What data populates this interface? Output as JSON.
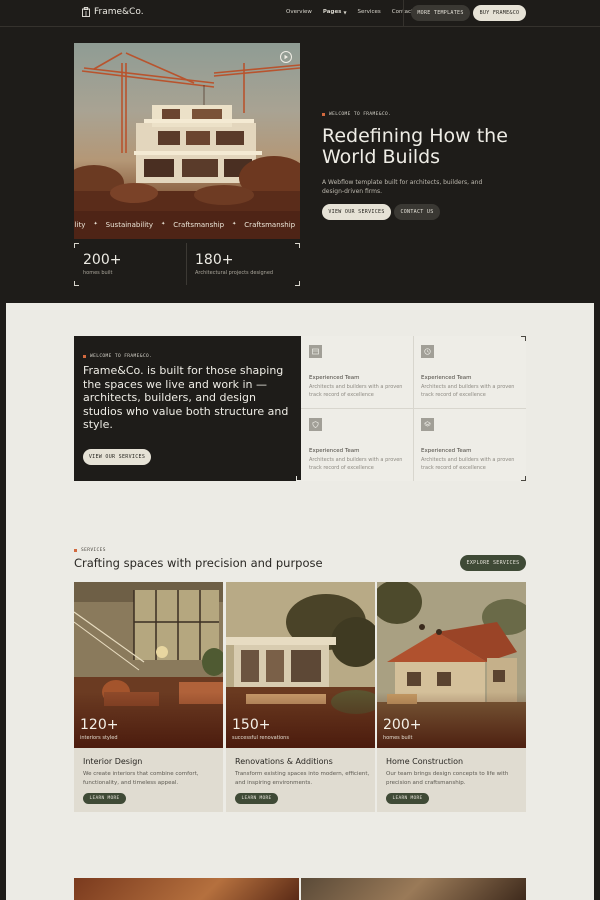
{
  "nav": {
    "brand": "Frame&Co.",
    "links": [
      "Overview",
      "Pages",
      "Services",
      "Contact"
    ],
    "more_templates": "MORE TEMPLATES",
    "buy": "BUY FRAME&CO"
  },
  "hero": {
    "eyebrow": "WELCOME TO FRAME&CO.",
    "title": "Redefining How the World Builds",
    "subtitle": "A Webflow template built for architects, builders, and design-driven firms.",
    "primary_button": "VIEW OUR SERVICES",
    "secondary_button": "CONTACT US",
    "ticker": [
      "ability",
      "Sustainability",
      "Craftsmanship",
      "Craftsmanship"
    ],
    "stats": [
      {
        "value": "200+",
        "label": "homes built"
      },
      {
        "value": "180+",
        "label": "Architectural projects designed"
      }
    ]
  },
  "about": {
    "eyebrow": "WELCOME TO FRAME&CO.",
    "text": "Frame&Co. is built for those shaping the spaces we live and work in — architects, builders, and design studios who value both structure and style.",
    "button": "VIEW OUR SERVICES",
    "features": [
      {
        "icon": "team-icon",
        "title": "Experienced Team",
        "desc": "Architects and builders with a proven track record of excellence"
      },
      {
        "icon": "clock-icon",
        "title": "Experienced Team",
        "desc": "Architects and builders with a proven track record of excellence"
      },
      {
        "icon": "shield-icon",
        "title": "Experienced Team",
        "desc": "Architects and builders with a proven track record of excellence"
      },
      {
        "icon": "layers-icon",
        "title": "Experienced Team",
        "desc": "Architects and builders with a proven track record of excellence"
      }
    ]
  },
  "services": {
    "eyebrow": "SERVICES",
    "title": "Crafting spaces with precision and purpose",
    "explore": "EXPLORE SERVICES",
    "cards": [
      {
        "value": "120+",
        "label": "interiors styled",
        "title": "Interior Design",
        "desc": "We create interiors that combine comfort, functionality, and timeless appeal.",
        "button": "LEARN MORE"
      },
      {
        "value": "150+",
        "label": "successful renovations",
        "title": "Renovations & Additions",
        "desc": "Transform existing spaces into modern, efficient, and inspiring environments.",
        "button": "LEARN MORE"
      },
      {
        "value": "200+",
        "label": "homes built",
        "title": "Home Construction",
        "desc": "Our team brings design concepts to life with precision and craftsmanship.",
        "button": "LEARN MORE"
      }
    ]
  },
  "colors": {
    "dark_bg": "#1e1c19",
    "light_bg": "#ecebe5",
    "accent": "#d2693e",
    "green_button": "#3f4a36"
  }
}
